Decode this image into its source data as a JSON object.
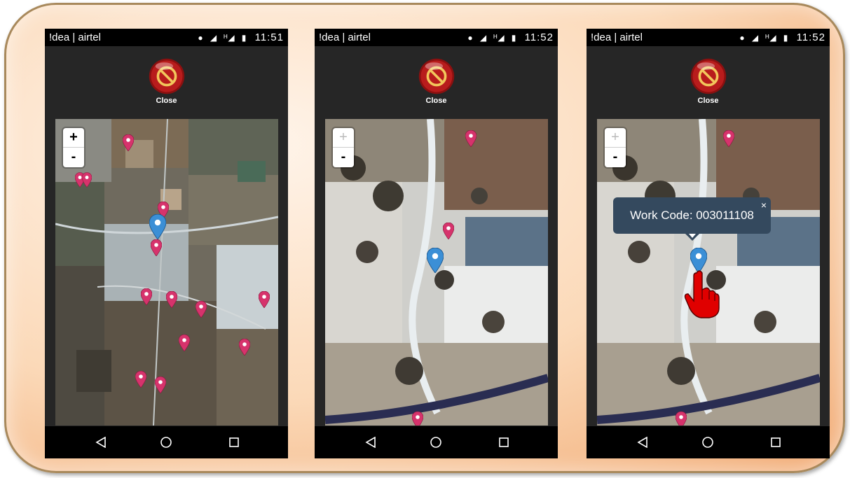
{
  "colors": {
    "frame_border": "#a8895c",
    "pin_marker": "#d6336c",
    "current_marker": "#3b8fd6",
    "popup_bg": "#34495e"
  },
  "screens": [
    {
      "status": {
        "carrier": "!dea | airtel",
        "time": "11:51",
        "icons": [
          "signal-icon",
          "network-h-icon",
          "battery-icon"
        ]
      },
      "close_label": "Close",
      "zoom_in": "+",
      "zoom_out": "-",
      "map_detail": "city"
    },
    {
      "status": {
        "carrier": "!dea | airtel",
        "time": "11:52",
        "icons": [
          "signal-icon",
          "network-h-icon",
          "battery-icon"
        ]
      },
      "close_label": "Close",
      "zoom_in": "+",
      "zoom_out": "-",
      "map_detail": "field"
    },
    {
      "status": {
        "carrier": "!dea | airtel",
        "time": "11:52",
        "icons": [
          "signal-icon",
          "network-h-icon",
          "battery-icon"
        ]
      },
      "close_label": "Close",
      "zoom_in": "+",
      "zoom_out": "-",
      "map_detail": "field",
      "popup": {
        "text": "Work Code: 003011108",
        "close": "×"
      }
    }
  ]
}
